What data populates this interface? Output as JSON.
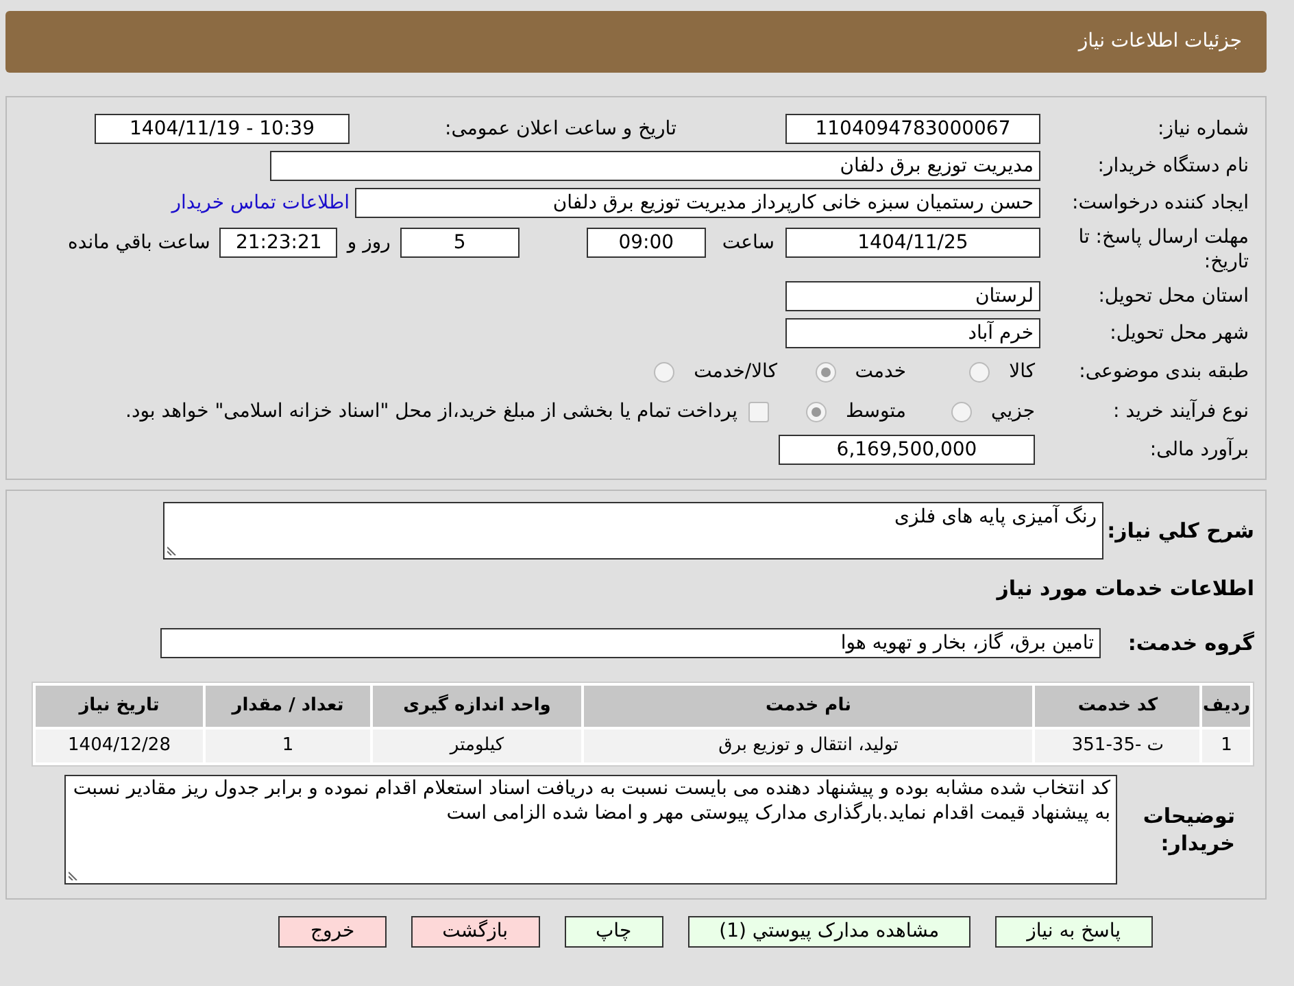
{
  "header": {
    "title": "جزئیات اطلاعات نیاز"
  },
  "need_number": {
    "label": "شماره نیاز:",
    "value": "1104094783000067"
  },
  "announce": {
    "label": "تاریخ و ساعت اعلان عمومی:",
    "value": "1404/11/19 - 10:39"
  },
  "buyer": {
    "label": "نام دستگاه خریدار:",
    "value": "مدیریت توزیع برق دلفان"
  },
  "requester": {
    "label": "ایجاد کننده درخواست:",
    "value": "حسن رستمیان سبزه خانی کارپرداز مدیریت توزیع برق دلفان",
    "link": "اطلاعات تماس خریدار"
  },
  "deadline": {
    "label": "مهلت ارسال پاسخ: تا تاریخ:",
    "date": "1404/11/25",
    "time_label": "ساعت",
    "time": "09:00",
    "days": "5",
    "days_label": "روز و",
    "remaining": "21:23:21",
    "remaining_label": "ساعت باقي مانده"
  },
  "province": {
    "label": "استان محل تحویل:",
    "value": "لرستان"
  },
  "city": {
    "label": "شهر محل تحویل:",
    "value": "خرم آباد"
  },
  "category": {
    "label": "طبقه بندی موضوعی:",
    "options": [
      {
        "label": "کالا",
        "selected": false
      },
      {
        "label": "خدمت",
        "selected": true
      },
      {
        "label": "کالا/خدمت",
        "selected": false
      }
    ]
  },
  "purchase_type": {
    "label": "نوع فرآیند خرید :",
    "options": [
      {
        "label": "جزيي",
        "selected": false
      },
      {
        "label": "متوسط",
        "selected": true
      }
    ],
    "treasury": {
      "label": "پرداخت تمام یا بخشی از مبلغ خرید،از محل \"اسناد خزانه اسلامی\" خواهد بود.",
      "checked": false
    }
  },
  "budget": {
    "label": "برآورد مالی:",
    "value": "6,169,500,000"
  },
  "summary": {
    "label": "شرح کلي نياز:",
    "value": "رنگ آمیزی پایه های فلزی"
  },
  "services_title": "اطلاعات خدمات مورد نياز",
  "service_group": {
    "label": "گروه خدمت:",
    "value": "تامین برق، گاز، بخار و تهویه هوا"
  },
  "table": {
    "columns": [
      "ردیف",
      "کد خدمت",
      "نام خدمت",
      "واحد اندازه گیری",
      "تعداد / مقدار",
      "تاریخ نیاز"
    ],
    "rows": [
      [
        "1",
        "ت -35-351",
        "تولید، انتقال و توزیع برق",
        "کیلومتر",
        "1",
        "1404/12/28"
      ]
    ]
  },
  "notes": {
    "label": "توضیحات خریدار:",
    "value": "کد انتخاب شده مشابه بوده و پیشنهاد دهنده می بایست نسبت به دریافت اسناد استعلام  اقدام نموده و برابر جدول ریز مقادیر نسبت به پیشنهاد قیمت اقدام نماید.بارگذاری مدارک پیوستی مهر و امضا شده الزامی است"
  },
  "buttons": [
    {
      "label": "پاسخ به نياز",
      "kind": "action"
    },
    {
      "label": "مشاهده مدارک پيوستي (1)",
      "kind": "action"
    },
    {
      "label": "چاپ",
      "kind": "action"
    },
    {
      "label": "بازگشت",
      "kind": "exit"
    },
    {
      "label": "خروج",
      "kind": "exit"
    }
  ]
}
